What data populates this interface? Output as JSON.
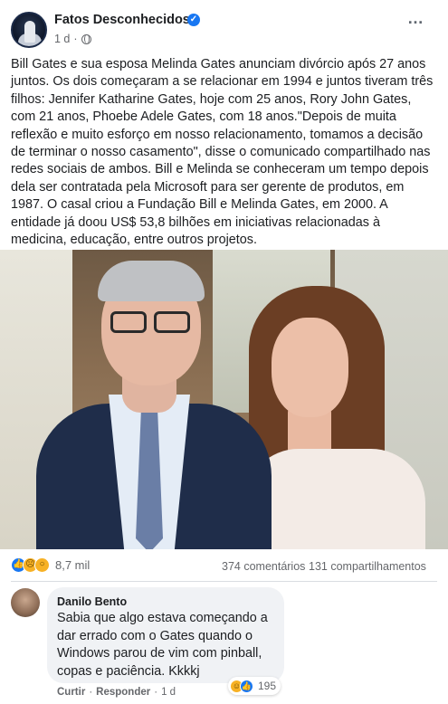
{
  "post": {
    "page_name": "Fatos Desconhecidos",
    "timestamp": "1 d",
    "separator": "·",
    "more_icon": "…",
    "text": "Bill Gates e sua esposa Melinda Gates anunciam divórcio após 27 anos juntos. Os dois começaram a se relacionar em 1994 e juntos tiveram três filhos: Jennifer Katharine Gates, hoje com 25 anos, Rory John Gates, com 21 anos, Phoebe Adele Gates, com 18 anos.\"Depois de muita reflexão e muito esforço em nosso relacionamento, tomamos a decisão de terminar o nosso casamento\", disse o comunicado compartilhado nas redes sociais de ambos. Bill e Melinda se conheceram um tempo depois dela ser contratada pela Microsoft para ser gerente de produtos, em 1987. O casal criou a Fundação Bill e Melinda Gates, em 2000. A entidade já doou US$ 53,8 bilhões em iniciativas relacionadas à medicina, educação, entre outros projetos.",
    "reaction_count": "8,7 mil",
    "comments_count": "374 comentários",
    "shares_count": "131 compartilhamentos"
  },
  "comment": {
    "author": "Danilo Bento",
    "text": "Sabia que algo estava começando a dar errado com o Gates quando o Windows parou de vim com pinball, copas e paciência. Kkkkj",
    "reaction_count": "195",
    "like_label": "Curtir",
    "reply_label": "Responder",
    "separator": "·",
    "timestamp": "1 d"
  },
  "colors": {
    "accent": "#1877f2",
    "secondary_text": "#65676b",
    "bubble": "#f0f2f5"
  }
}
